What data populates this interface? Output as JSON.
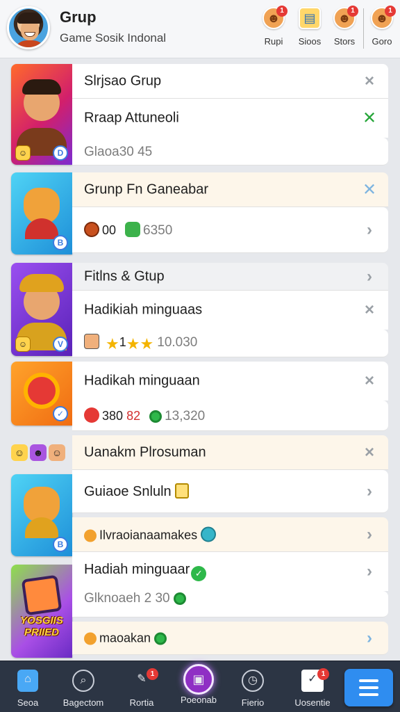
{
  "header": {
    "title": "Grup",
    "subtitle": "Game Sosik Indonal",
    "actions": [
      {
        "label": "Rupi",
        "badge": "1",
        "icon": "bell-icon"
      },
      {
        "label": "Sioos",
        "badge": "",
        "icon": "clipboard-icon"
      },
      {
        "label": "Stors",
        "badge": "1",
        "icon": "store-icon"
      },
      {
        "label": "Goro",
        "badge": "1",
        "icon": "profile-icon"
      }
    ]
  },
  "rows": [
    {
      "text": "Slrjsao Grup",
      "action": "×"
    },
    {
      "text": "Rraap Attuneoli",
      "action": "✕"
    },
    {
      "text": "Glaoa30 45"
    },
    {
      "text": "Grunp Fn Ganeabar",
      "action": "✕"
    },
    {
      "text_a": "00",
      "text_b": "6350",
      "action": "›"
    },
    {
      "text": "Fitlns & Gtup",
      "action": "›"
    },
    {
      "text": "Hadikiah minguaas",
      "action": "×"
    },
    {
      "text_a": "1",
      "text_b": "10.0̰",
      "raw": "1 10.030",
      "action": ""
    },
    {
      "text": "Hadikah minguaan",
      "action": "×"
    },
    {
      "text_a": "380",
      "text_b": "82",
      "text_c": "13,320",
      "action": ""
    },
    {
      "text": "Uanakm Plrosuman",
      "action": "×"
    },
    {
      "text": "Guiaoe Snluln",
      "action": "›"
    },
    {
      "text": "Ilvraoianaamakes",
      "action": "›"
    },
    {
      "text": "Hadiah minguaar",
      "action": "›"
    },
    {
      "text": "Glknoaeh 2 30"
    },
    {
      "text": "maoakan",
      "action": "›"
    }
  ],
  "thumbs": [
    {
      "tag": ""
    },
    {
      "tag": ""
    },
    {
      "tag": ""
    },
    {
      "tag": ""
    },
    {
      "tag": ""
    },
    {
      "tag": "YOSGIIS PRIIED"
    }
  ],
  "nav": {
    "items": [
      {
        "label": "Seoa",
        "badge": ""
      },
      {
        "label": "Bagectom",
        "badge": ""
      },
      {
        "label": "Rortia",
        "badge": "1"
      },
      {
        "label": "Poeonab",
        "badge": ""
      },
      {
        "label": "Fierio",
        "badge": ""
      },
      {
        "label": "Uosentie",
        "badge": "1"
      }
    ]
  },
  "colors": {
    "accent": "#2f8df0",
    "nav_bg": "#2c3544",
    "badge": "#e53935",
    "accept": "#27a63a"
  }
}
